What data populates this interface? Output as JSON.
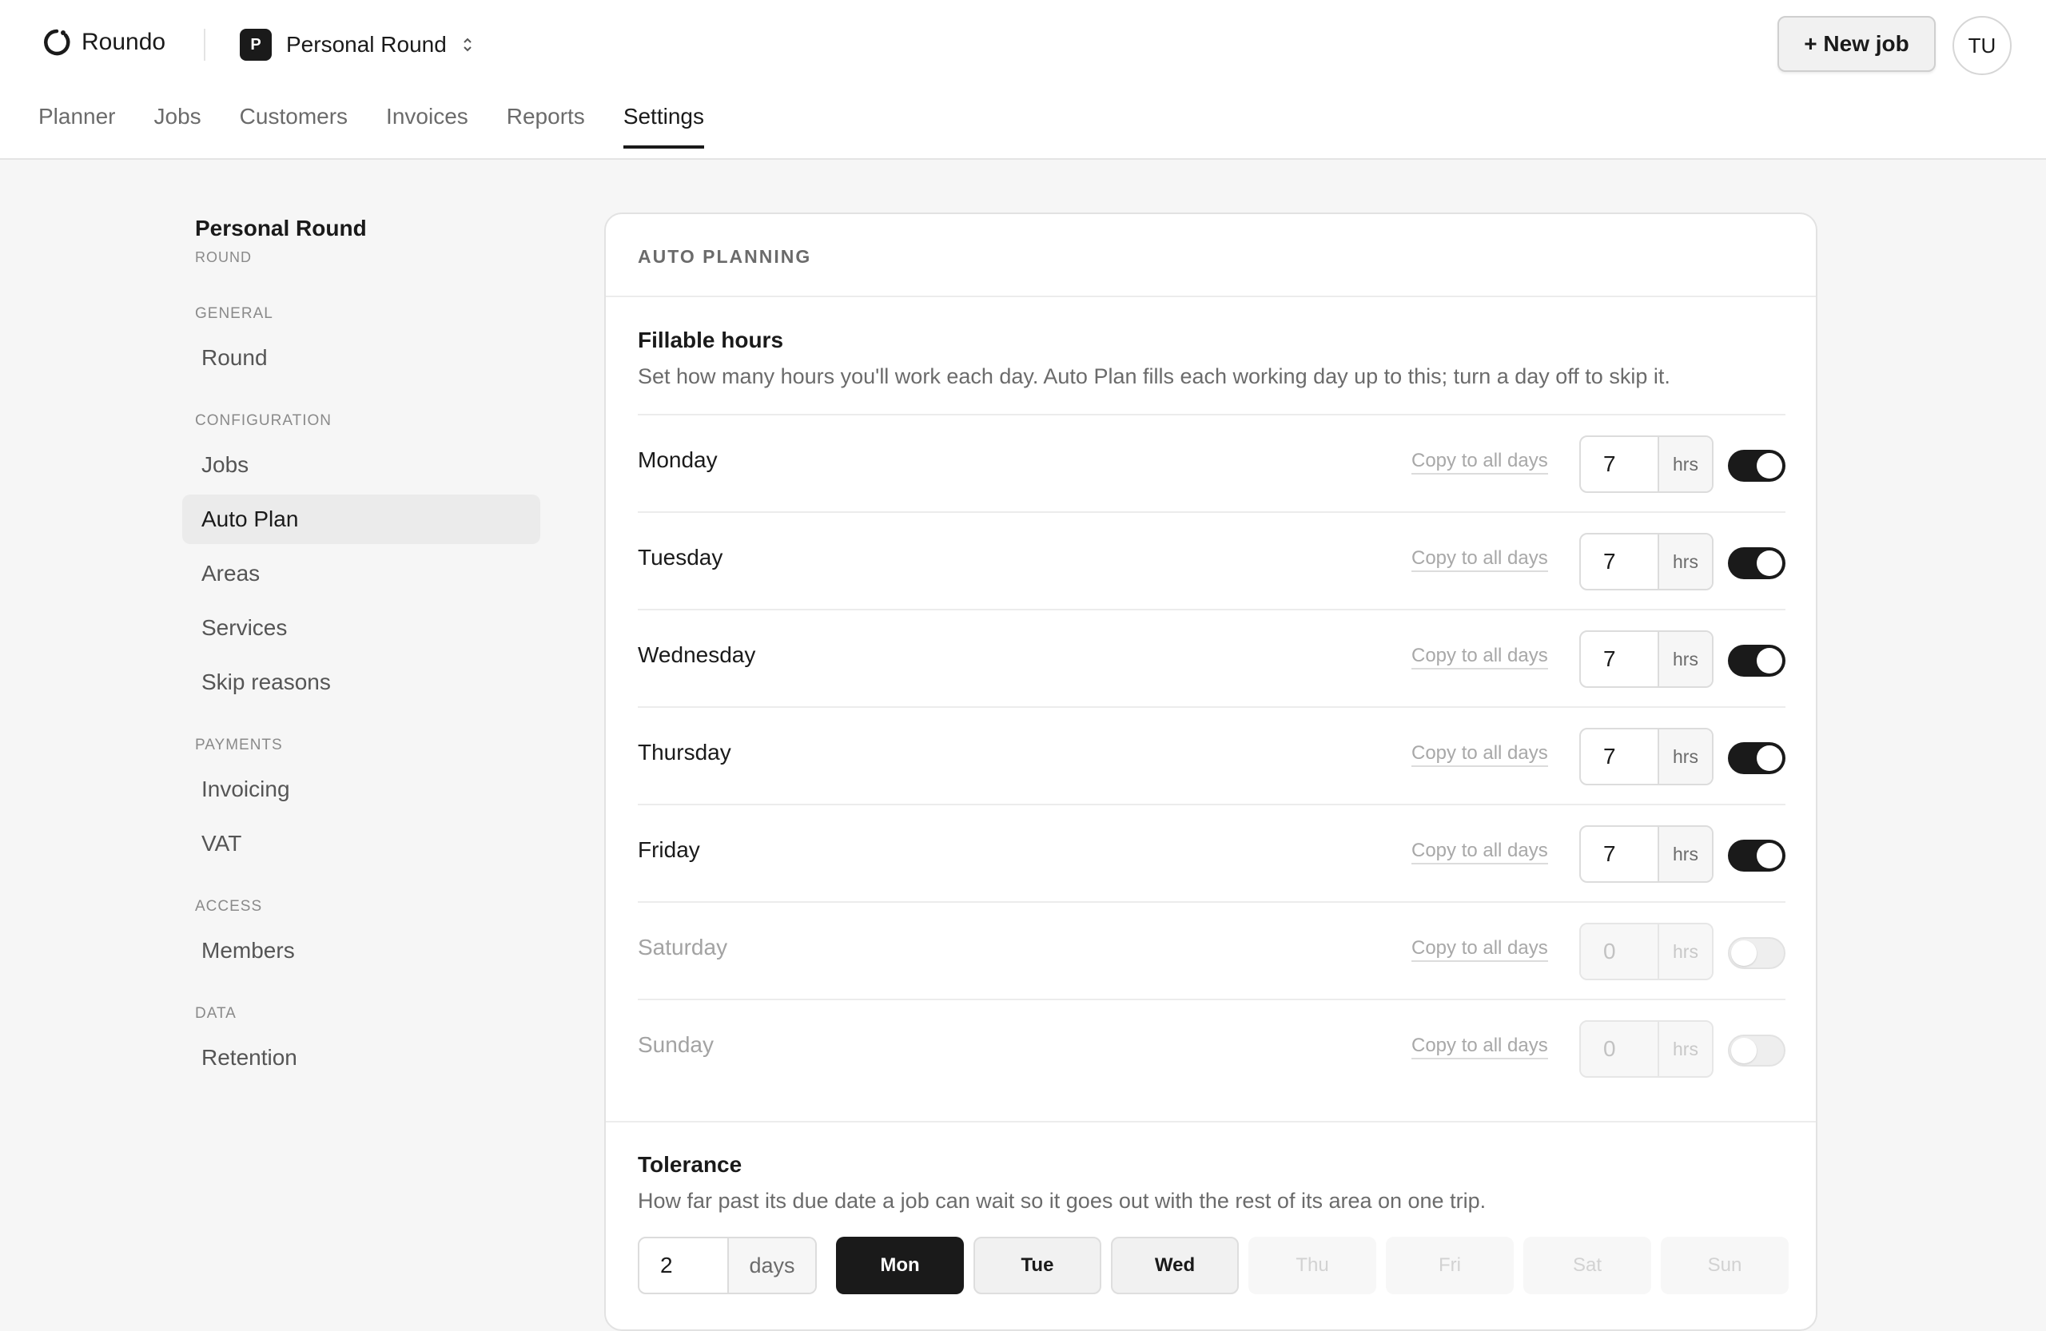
{
  "app": {
    "name": "Roundo"
  },
  "workspace": {
    "badge": "P",
    "name": "Personal Round",
    "chevron": "⌃⌄"
  },
  "header": {
    "new_job_label": "+ New job",
    "avatar_initials": "TU"
  },
  "nav": {
    "tabs": [
      {
        "label": "Planner",
        "active": false
      },
      {
        "label": "Jobs",
        "active": false
      },
      {
        "label": "Customers",
        "active": false
      },
      {
        "label": "Invoices",
        "active": false
      },
      {
        "label": "Reports",
        "active": false
      },
      {
        "label": "Settings",
        "active": true
      }
    ]
  },
  "sidebar": {
    "title": "Personal Round",
    "subtitle": "ROUND",
    "groups": [
      {
        "label": "GENERAL",
        "items": [
          "Round"
        ]
      },
      {
        "label": "CONFIGURATION",
        "items": [
          "Jobs",
          "Auto Plan",
          "Areas",
          "Services",
          "Skip reasons"
        ]
      },
      {
        "label": "PAYMENTS",
        "items": [
          "Invoicing",
          "VAT"
        ]
      },
      {
        "label": "ACCESS",
        "items": [
          "Members"
        ]
      },
      {
        "label": "DATA",
        "items": [
          "Retention"
        ]
      }
    ],
    "active_item": "Auto Plan"
  },
  "card": {
    "heading": "AUTO PLANNING",
    "fillable": {
      "title": "Fillable hours",
      "description": "Set how many hours you'll work each day. Auto Plan fills each working day up to this; turn a day off to skip it.",
      "copy_label": "Copy to all days",
      "unit": "hrs",
      "days": [
        {
          "name": "Monday",
          "hours": "7",
          "enabled": true
        },
        {
          "name": "Tuesday",
          "hours": "7",
          "enabled": true
        },
        {
          "name": "Wednesday",
          "hours": "7",
          "enabled": true
        },
        {
          "name": "Thursday",
          "hours": "7",
          "enabled": true
        },
        {
          "name": "Friday",
          "hours": "7",
          "enabled": true
        },
        {
          "name": "Saturday",
          "hours": "0",
          "enabled": false
        },
        {
          "name": "Sunday",
          "hours": "0",
          "enabled": false
        }
      ]
    },
    "tolerance": {
      "title": "Tolerance",
      "description": "How far past its due date a job can wait so it goes out with the rest of its area on one trip.",
      "value": "2",
      "unit": "days",
      "days": [
        {
          "label": "Mon",
          "state": "selected"
        },
        {
          "label": "Tue",
          "state": "included"
        },
        {
          "label": "Wed",
          "state": "included"
        },
        {
          "label": "Thu",
          "state": "dim"
        },
        {
          "label": "Fri",
          "state": "dim"
        },
        {
          "label": "Sat",
          "state": "dim"
        },
        {
          "label": "Sun",
          "state": "dim"
        }
      ]
    }
  },
  "colors": {
    "accent": "#1a1a1a",
    "background": "#f6f6f6",
    "muted_text": "#6b6b6b"
  }
}
